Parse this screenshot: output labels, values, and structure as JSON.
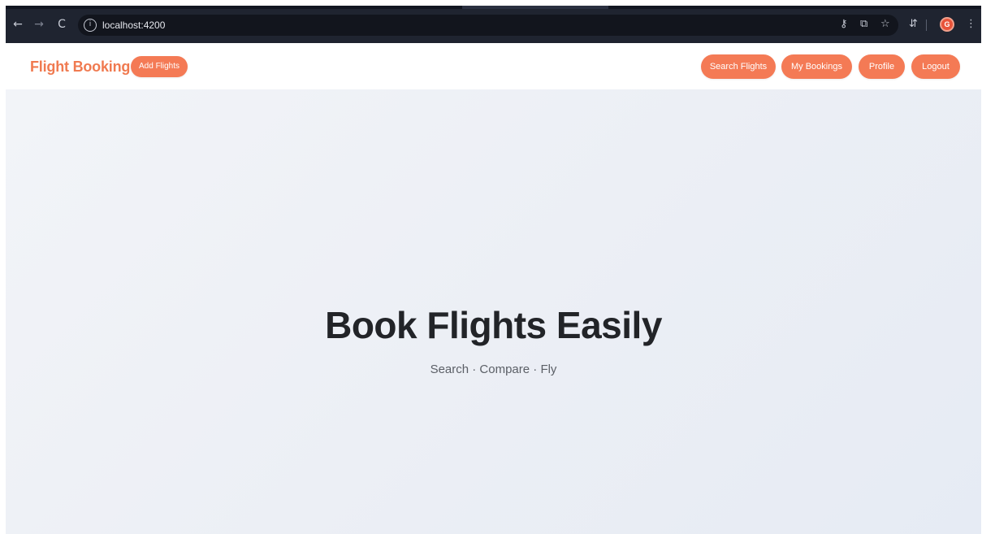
{
  "browser": {
    "url": "localhost:4200",
    "icons": {
      "back": "←",
      "forward": "→",
      "reload": "C",
      "site_info": "i",
      "password": "⚷",
      "translate": "⧉",
      "bookmark": "☆",
      "extensions": "⇵",
      "menu": "⋮",
      "profile": "G"
    }
  },
  "header": {
    "brand": "Flight Booking",
    "add_flights": "Add Flights",
    "nav": {
      "search_flights": "Search Flights",
      "my_bookings": "My Bookings",
      "profile": "Profile",
      "logout": "Logout"
    }
  },
  "hero": {
    "title": "Book Flights Easily",
    "subtitle": "Search · Compare · Fly"
  },
  "colors": {
    "accent": "#f47a55",
    "brand_text": "#f07a50",
    "chrome_bg": "#1f2430",
    "hero_bg": "#eef1f7",
    "title_text": "#222428"
  }
}
